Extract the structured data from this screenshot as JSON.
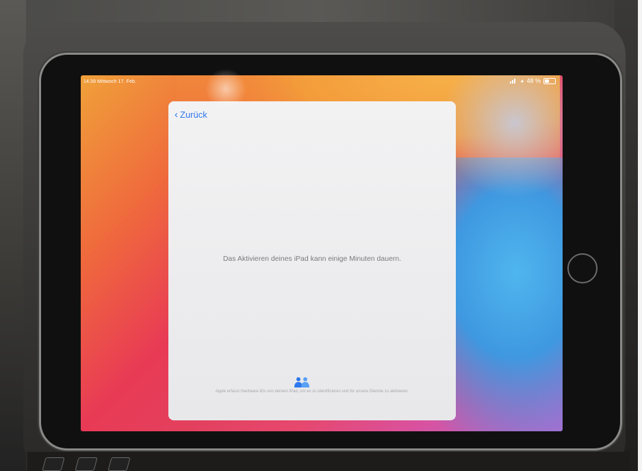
{
  "status_bar": {
    "time_date": "14:39  Mittwoch 17. Feb.",
    "battery": "48 %"
  },
  "sheet": {
    "back_label": "Zurück",
    "message": "Das Aktivieren deines iPad kann einige Minuten dauern.",
    "footer": "Apple erfasst Hardware-IDs von deinem iPad, um es zu identifizieren und für unsere Dienste zu aktivieren."
  },
  "colors": {
    "accent": "#2f78ee",
    "sheet_bg": "#efeff0",
    "text_secondary": "#7a7a7e"
  },
  "icons": [
    "back-chevron-icon",
    "people-icon",
    "signal-icon",
    "wifi-icon",
    "battery-icon",
    "home-button"
  ]
}
